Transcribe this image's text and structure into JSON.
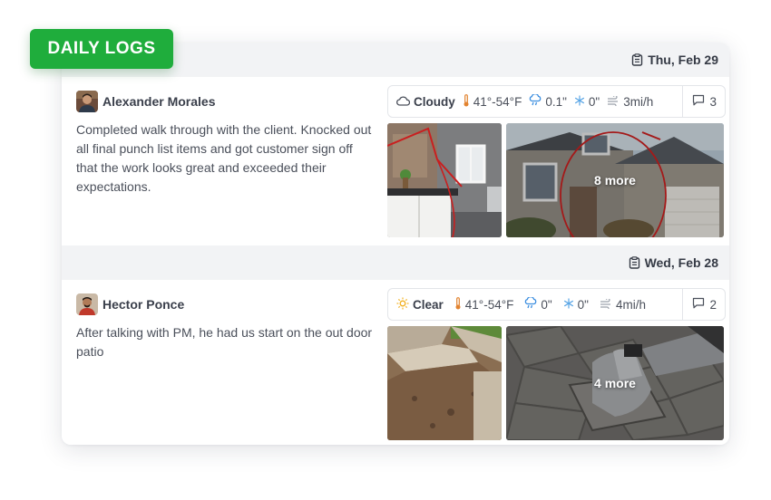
{
  "badge": {
    "label": "DAILY LOGS"
  },
  "colors": {
    "badge": "#1fad3c",
    "thermometer": "#e2832f",
    "sun": "#f2b01e",
    "precip": "#3d8fe0",
    "snow": "#5aa6e6"
  },
  "logs": [
    {
      "date": "Thu, Feb 29",
      "author": "Alexander Morales",
      "note": "Completed walk through with the client. Knocked out all final punch list items and got customer sign off that the work looks great and exceeded their expectations.",
      "weather": {
        "condition": "Cloudy",
        "condition_icon": "cloud-icon",
        "temperature": "41°-54°F",
        "precipitation": "0.1\"",
        "snow": "0\"",
        "wind": "3mi/h"
      },
      "comments": "3",
      "more_photos": "8 more"
    },
    {
      "date": "Wed, Feb 28",
      "author": "Hector Ponce",
      "note": "After talking with PM, he had us start on the out door patio",
      "weather": {
        "condition": "Clear",
        "condition_icon": "sun-icon",
        "temperature": "41°-54°F",
        "precipitation": "0\"",
        "snow": "0\"",
        "wind": "4mi/h"
      },
      "comments": "2",
      "more_photos": "4 more"
    }
  ]
}
